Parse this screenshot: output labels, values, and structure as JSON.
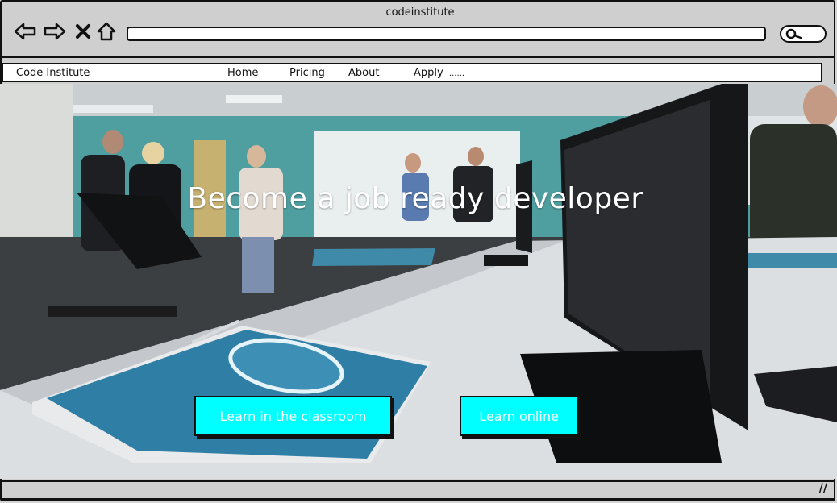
{
  "window": {
    "title": "codeinstitute"
  },
  "toolbar": {
    "icons": [
      "back-icon",
      "forward-icon",
      "close-icon",
      "home-icon"
    ],
    "address_value": "",
    "search_icon": "search-icon"
  },
  "navbar": {
    "brand": "Code Institute",
    "items": [
      {
        "label": "Home"
      },
      {
        "label": "Pricing"
      },
      {
        "label": "About"
      },
      {
        "label": "Apply"
      },
      {
        "label": "......"
      }
    ]
  },
  "hero": {
    "headline": "Become a job ready developer",
    "image": "classroom-photo",
    "buttons": [
      {
        "label": "Learn in the classroom"
      },
      {
        "label": "Learn online"
      }
    ]
  },
  "status_bar": {
    "resize_icon": "resize-grip-icon"
  },
  "colors": {
    "cta": "#00ffff",
    "frame": "#cfcfcf",
    "border": "#111111"
  }
}
